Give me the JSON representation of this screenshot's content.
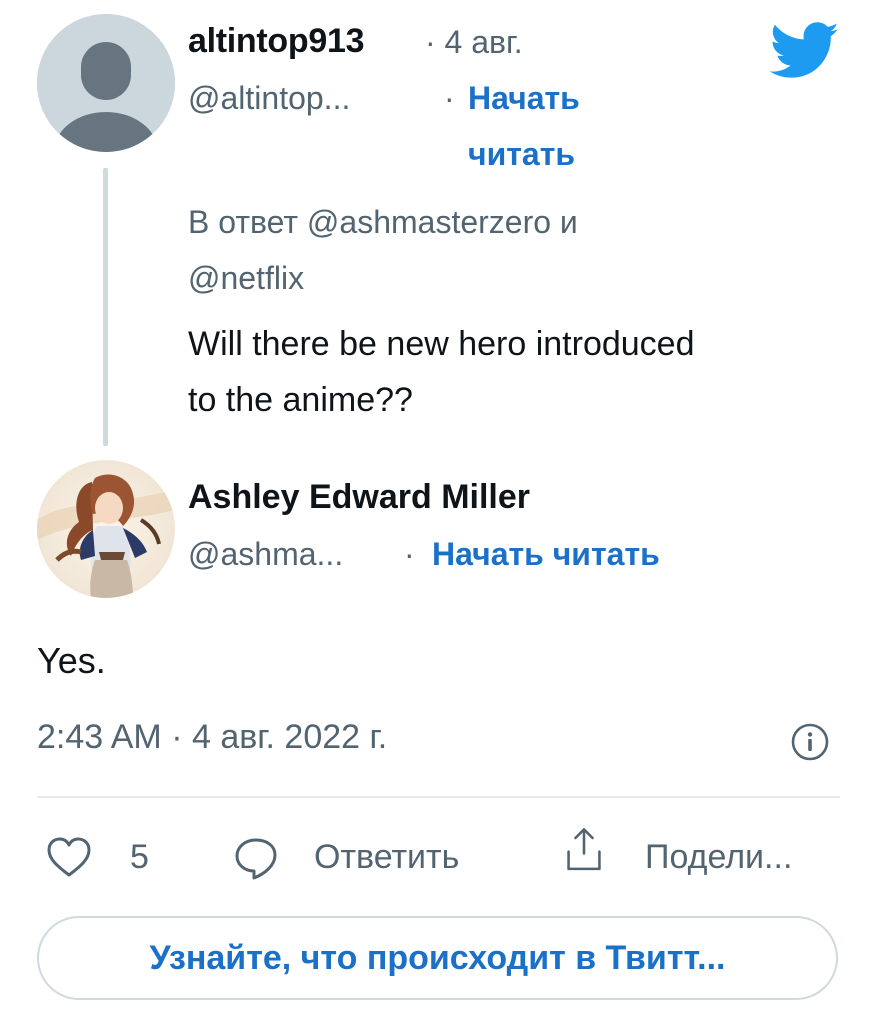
{
  "parent_tweet": {
    "display_name": "altintop913",
    "date_separator": "· 4 авг.",
    "handle": "@altintop...",
    "dot": "·",
    "follow_line1": "Начать",
    "follow_line2": "читать",
    "reply_to_line1": "В ответ @ashmasterzero и",
    "reply_to_line2": "@netflix",
    "text_line1": "Will there be new hero introduced",
    "text_line2": "to the anime??"
  },
  "main_tweet": {
    "display_name": "Ashley Edward Miller",
    "handle": "@ashma...",
    "dot": "·",
    "follow": "Начать читать",
    "text": "Yes.",
    "timestamp": "2:43 AM · 4 авг. 2022 г."
  },
  "actions": {
    "likes": "5",
    "reply": "Ответить",
    "share": "Подели..."
  },
  "cta": "Узнайте, что происходит в Твитт...",
  "icons": {
    "logo": "twitter-bird-icon",
    "info": "info-icon",
    "like": "heart-icon",
    "reply": "reply-bubble-icon",
    "share": "share-icon"
  },
  "colors": {
    "link": "#1b70c7",
    "twitter_blue": "#1d9bf0",
    "secondary_text": "#536471"
  }
}
